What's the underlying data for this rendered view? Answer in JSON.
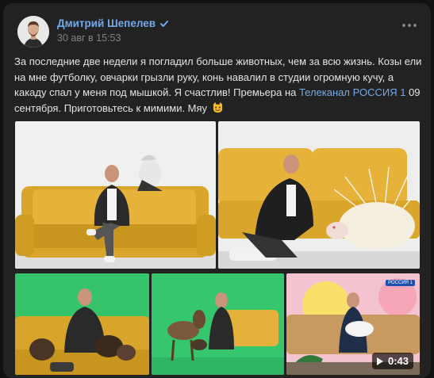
{
  "post": {
    "author": "Дмитрий Шепелев",
    "date": "30 авг в 15:53",
    "text_before_link": "За последние две недели я погладил больше животных, чем за всю жизнь. Козы ели на мне футболку, овчарки грызли руку, конь навалил в студии огромную кучу, а какаду спал у меня под мышкой. Я счастлив! Премьера на ",
    "link_text": "Телеканал РОССИЯ 1",
    "text_after_link": " 09 сентября. Приготовьтесь к мимими. Мяу",
    "emoji": "smiling-cat-emoji"
  },
  "media": {
    "video_duration": "0:43",
    "channel_badge": "РОССИЯ 1"
  },
  "colors": {
    "card_bg": "#222222",
    "link": "#71aaeb",
    "text": "#e1e3e6",
    "meta": "#828282"
  }
}
